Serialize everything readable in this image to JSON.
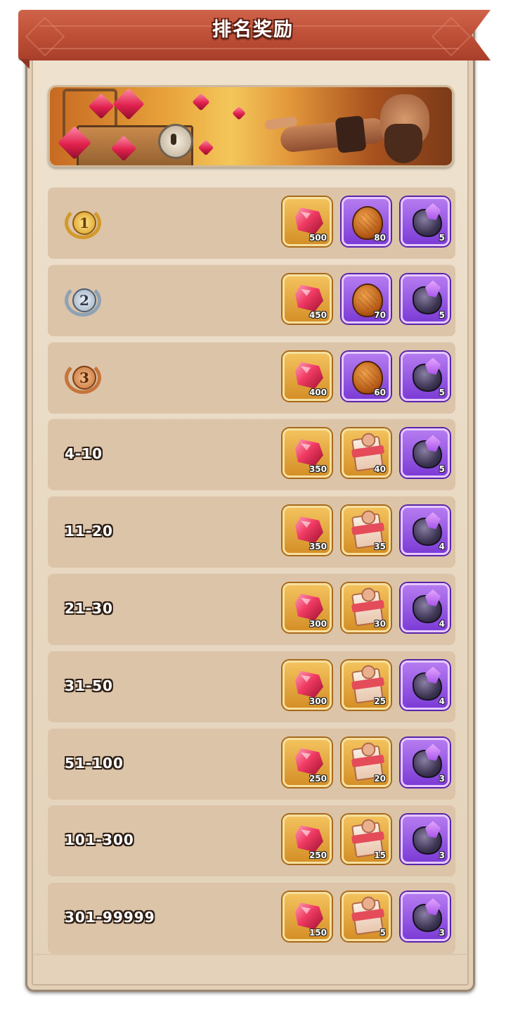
{
  "header": {
    "title": "排名奖励"
  },
  "colors": {
    "ribbon": "#bd4e36",
    "panel": "#e8d8c1",
    "row": "#dcc4a9",
    "gold_tile": "#e2a43c",
    "purple_tile": "#9a5ae4"
  },
  "rows": [
    {
      "rank": "",
      "medal": "gold",
      "medal_num": "1",
      "rewards": [
        {
          "icon": "ruby-icon",
          "tile": "gold",
          "qty": "500"
        },
        {
          "icon": "dragon-egg-icon",
          "tile": "purple",
          "qty": "80"
        },
        {
          "icon": "dark-stone-icon",
          "tile": "purple",
          "qty": "5"
        }
      ]
    },
    {
      "rank": "",
      "medal": "silver",
      "medal_num": "2",
      "rewards": [
        {
          "icon": "ruby-icon",
          "tile": "gold",
          "qty": "450"
        },
        {
          "icon": "dragon-egg-icon",
          "tile": "purple",
          "qty": "70"
        },
        {
          "icon": "dark-stone-icon",
          "tile": "purple",
          "qty": "5"
        }
      ]
    },
    {
      "rank": "",
      "medal": "bronze",
      "medal_num": "3",
      "rewards": [
        {
          "icon": "ruby-icon",
          "tile": "gold",
          "qty": "400"
        },
        {
          "icon": "dragon-egg-icon",
          "tile": "purple",
          "qty": "60"
        },
        {
          "icon": "dark-stone-icon",
          "tile": "purple",
          "qty": "5"
        }
      ]
    },
    {
      "rank": "4-10",
      "rewards": [
        {
          "icon": "ruby-icon",
          "tile": "gold",
          "qty": "350"
        },
        {
          "icon": "puzzle-scroll-icon",
          "tile": "gold",
          "qty": "40"
        },
        {
          "icon": "dark-stone-icon",
          "tile": "purple",
          "qty": "5"
        }
      ]
    },
    {
      "rank": "11-20",
      "rewards": [
        {
          "icon": "ruby-icon",
          "tile": "gold",
          "qty": "350"
        },
        {
          "icon": "puzzle-scroll-icon",
          "tile": "gold",
          "qty": "35"
        },
        {
          "icon": "dark-stone-icon",
          "tile": "purple",
          "qty": "4"
        }
      ]
    },
    {
      "rank": "21-30",
      "rewards": [
        {
          "icon": "ruby-icon",
          "tile": "gold",
          "qty": "300"
        },
        {
          "icon": "puzzle-scroll-icon",
          "tile": "gold",
          "qty": "30"
        },
        {
          "icon": "dark-stone-icon",
          "tile": "purple",
          "qty": "4"
        }
      ]
    },
    {
      "rank": "31-50",
      "rewards": [
        {
          "icon": "ruby-icon",
          "tile": "gold",
          "qty": "300"
        },
        {
          "icon": "puzzle-scroll-icon",
          "tile": "gold",
          "qty": "25"
        },
        {
          "icon": "dark-stone-icon",
          "tile": "purple",
          "qty": "4"
        }
      ]
    },
    {
      "rank": "51-100",
      "rewards": [
        {
          "icon": "ruby-icon",
          "tile": "gold",
          "qty": "250"
        },
        {
          "icon": "puzzle-scroll-icon",
          "tile": "gold",
          "qty": "20"
        },
        {
          "icon": "dark-stone-icon",
          "tile": "purple",
          "qty": "3"
        }
      ]
    },
    {
      "rank": "101-300",
      "rewards": [
        {
          "icon": "ruby-icon",
          "tile": "gold",
          "qty": "250"
        },
        {
          "icon": "puzzle-scroll-icon",
          "tile": "gold",
          "qty": "15"
        },
        {
          "icon": "dark-stone-icon",
          "tile": "purple",
          "qty": "3"
        }
      ]
    },
    {
      "rank": "301-99999",
      "rewards": [
        {
          "icon": "ruby-icon",
          "tile": "gold",
          "qty": "150"
        },
        {
          "icon": "puzzle-scroll-icon",
          "tile": "gold",
          "qty": "5"
        },
        {
          "icon": "dark-stone-icon",
          "tile": "purple",
          "qty": "3"
        }
      ]
    }
  ]
}
